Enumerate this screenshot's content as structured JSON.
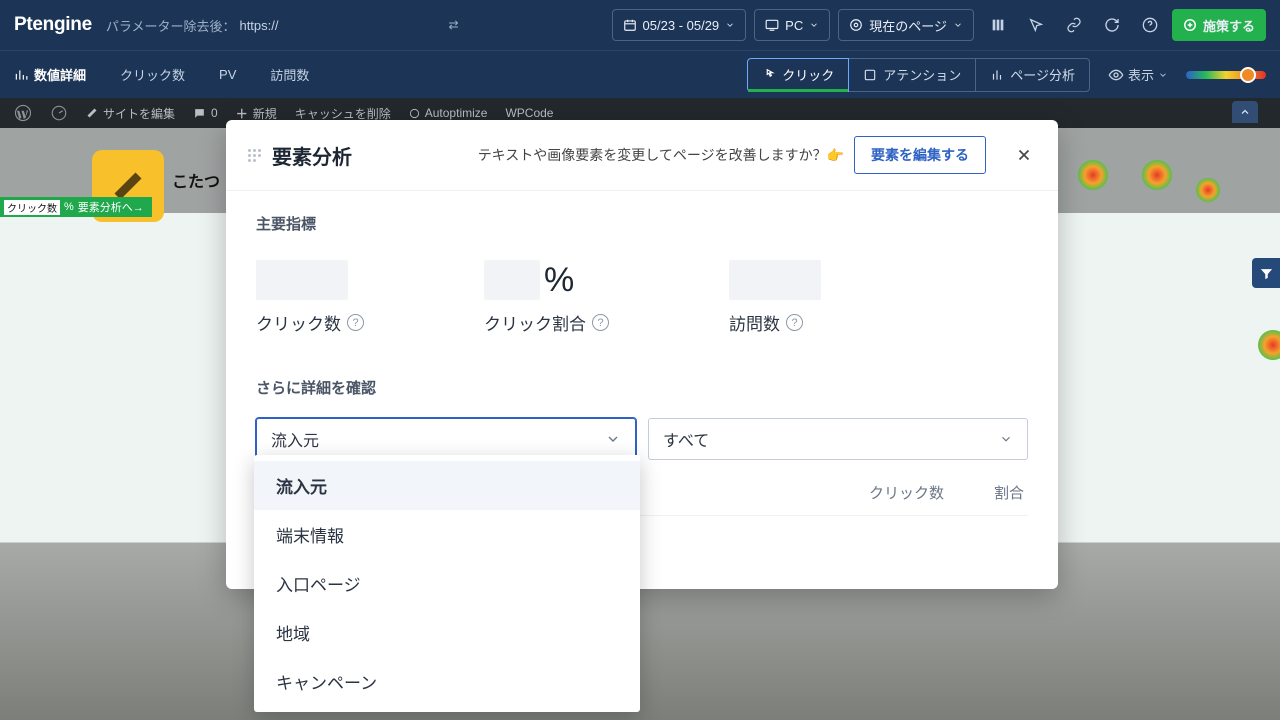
{
  "topbar": {
    "logo": "Ptengine",
    "param_label": "パラメーター除去後：",
    "param_url": "https://",
    "sync_glyph": "⇄",
    "date_range": "05/23 - 05/29",
    "device": "PC",
    "page_scope": "現在のページ",
    "cta": "施策する"
  },
  "subnav": {
    "metrics": "数値詳細",
    "clicks": "クリック数",
    "pv": "PV",
    "visits": "訪問数",
    "tab_click": "クリック",
    "tab_attention": "アテンション",
    "tab_analysis": "ページ分析",
    "display": "表示"
  },
  "wp": {
    "edit_site": "サイトを編集",
    "comments": "0",
    "new": "新規",
    "clear_cache": "キャッシュを削除",
    "autoptimize": "Autoptimize",
    "wpcode": "WPCode"
  },
  "badge": {
    "prefix": "クリック数",
    "pct": "%",
    "link": "要素分析へ→"
  },
  "banner": {
    "title": "こたつ"
  },
  "modal": {
    "title": "要素分析",
    "prompt": "テキストや画像要素を変更してページを改善しますか？👉",
    "edit": "要素を編集する",
    "main_metrics": "主要指標",
    "m_clicks": "クリック数",
    "m_rate": "クリック割合",
    "m_visits": "訪問数",
    "pct": "%",
    "more_detail": "さらに詳細を確認",
    "select_primary": "流入元",
    "select_secondary": "すべて",
    "col_clicks": "クリック数",
    "col_rate": "割合",
    "row_rate": "%"
  },
  "dropdown": {
    "items": [
      "流入元",
      "端末情報",
      "入口ページ",
      "地域",
      "キャンペーン"
    ]
  }
}
